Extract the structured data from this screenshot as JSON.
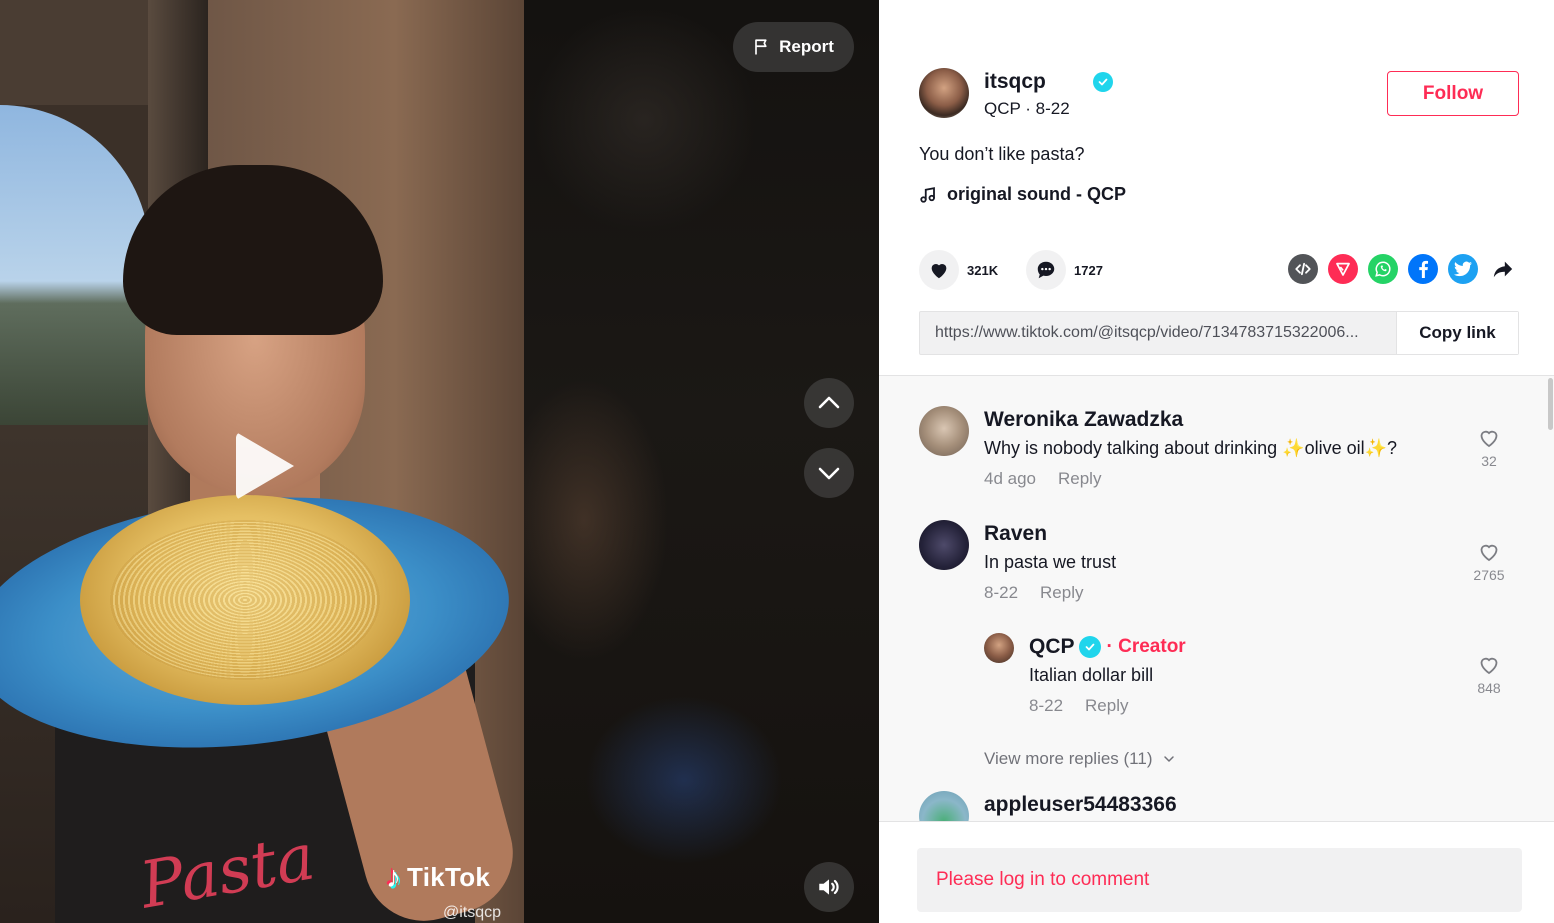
{
  "video": {
    "report_label": "Report",
    "watermark_brand": "TikTok",
    "watermark_handle": "@itsqcp",
    "shirt_text": "Pasta"
  },
  "author": {
    "username": "itsqcp",
    "nickname_date": "QCP · 8-22",
    "follow_label": "Follow"
  },
  "post": {
    "caption": "You don’t like pasta?",
    "music": "original sound - QCP",
    "likes": "321K",
    "comments": "1727",
    "share_icons": [
      "embed-icon",
      "send-icon",
      "whatsapp-icon",
      "facebook-icon",
      "twitter-icon",
      "share-arrow-icon"
    ],
    "link_url": "https://www.tiktok.com/@itsqcp/video/7134783715322006...",
    "copy_label": "Copy link"
  },
  "comments": [
    {
      "name": "Weronika Zawadzka",
      "text": "Why is nobody talking about drinking ✨olive oil✨?",
      "date": "4d ago",
      "reply": "Reply",
      "likes": "32"
    },
    {
      "name": "Raven",
      "text": "In pasta we trust",
      "date": "8-22",
      "reply": "Reply",
      "likes": "2765"
    },
    {
      "name": "QCP",
      "tag": "· Creator",
      "text": "Italian dollar bill",
      "date": "8-22",
      "reply": "Reply",
      "likes": "848"
    },
    {
      "name": "appleuser54483366"
    }
  ],
  "view_more": "View more replies (11)",
  "login_prompt": "Please log in to comment",
  "colors": {
    "accent": "#fe2c55",
    "verified": "#20d5ec",
    "text": "#161823"
  }
}
